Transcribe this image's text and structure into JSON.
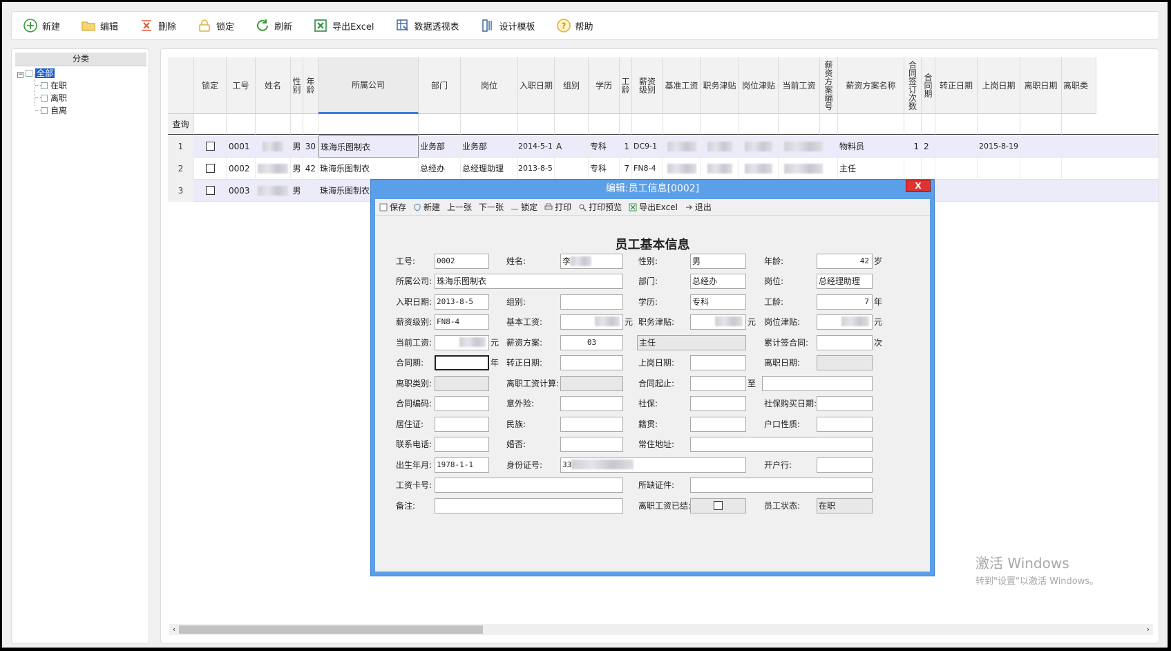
{
  "toolbar": {
    "new": "新建",
    "edit": "编辑",
    "delete": "删除",
    "lock": "锁定",
    "refresh": "刷新",
    "export": "导出Excel",
    "pivot": "数据透视表",
    "template": "设计模板",
    "help": "帮助"
  },
  "tree": {
    "header": "分类",
    "root": "全部",
    "children": [
      "在职",
      "离职",
      "自离"
    ]
  },
  "grid": {
    "filter_label": "查询",
    "headers": [
      "锁定",
      "工号",
      "姓名",
      "性别",
      "年龄",
      "所属公司",
      "部门",
      "岗位",
      "入职日期",
      "组别",
      "学历",
      "工龄",
      "薪资级别",
      "基准工资",
      "职务津贴",
      "岗位津贴",
      "当前工资",
      "薪资方案编号",
      "薪资方案名称",
      "合同签订次数",
      "合同期",
      "转正日期",
      "上岗日期",
      "离职日期",
      "离职类"
    ],
    "rows": [
      {
        "num": "1",
        "id": "0001",
        "gender": "男",
        "age": "30",
        "company": "珠海乐图制衣",
        "dept": "业务部",
        "post": "业务部",
        "hire_date": "2014-5-1",
        "group": "A",
        "edu": "专科",
        "seniority": "1",
        "grade": "DC9-1",
        "plan_name": "物料员",
        "contracts": "1",
        "contract_period": "2",
        "onpost_date": "2015-8-19"
      },
      {
        "num": "2",
        "id": "0002",
        "gender": "男",
        "age": "42",
        "company": "珠海乐图制衣",
        "dept": "总经办",
        "post": "总经理助理",
        "hire_date": "2013-8-5",
        "group": "",
        "edu": "专科",
        "seniority": "7",
        "grade": "FN8-4",
        "plan_name": "主任",
        "contracts": "",
        "contract_period": "",
        "onpost_date": ""
      },
      {
        "num": "3",
        "id": "0003",
        "gender": "男",
        "age": "",
        "company": "珠海乐图制衣",
        "dept": "",
        "post": "",
        "hire_date": "",
        "group": "",
        "edu": "",
        "seniority": "",
        "grade": "",
        "plan_name": "",
        "contracts": "",
        "contract_period": "",
        "onpost_date": ""
      }
    ]
  },
  "watermark": {
    "line1": "激活 Windows",
    "line2": "转到\"设置\"以激活 Windows。"
  },
  "dialog": {
    "title": "编辑:员工信息[0002]",
    "close": "X",
    "toolbar": {
      "save": "保存",
      "new": "新建",
      "prev": "上一张",
      "next": "下一张",
      "lock": "锁定",
      "print": "打印",
      "preview": "打印预览",
      "export": "导出Excel",
      "exit": "退出"
    },
    "form_title": "员工基本信息",
    "labels": {
      "id": "工号:",
      "name": "姓名:",
      "gender": "性别:",
      "age": "年龄:",
      "company": "所属公司:",
      "dept": "部门:",
      "post": "岗位:",
      "hire_date": "入职日期:",
      "group": "组别:",
      "edu": "学历:",
      "seniority": "工龄:",
      "grade": "薪资级别:",
      "base_salary": "基本工资:",
      "duty_allow": "职务津贴:",
      "post_allow": "岗位津贴:",
      "cur_salary": "当前工资:",
      "plan": "薪资方案:",
      "contracts": "累计签合同:",
      "contract_period": "合同期:",
      "confirm_date": "转正日期:",
      "onpost_date": "上岗日期:",
      "leave_date": "离职日期:",
      "leave_type": "离职类别:",
      "leave_calc": "离职工资计算:",
      "contract_range": "合同起止:",
      "contract_no": "合同编码:",
      "insurance": "意外险:",
      "social": "社保:",
      "social_date": "社保购买日期:",
      "residence": "居住证:",
      "ethnic": "民族:",
      "native": "籍贯:",
      "hukou": "户口性质:",
      "phone": "联系电话:",
      "married": "婚否:",
      "address": "常住地址:",
      "birth": "出生年月:",
      "idcard": "身份证号:",
      "bank": "开户行:",
      "salary_card": "工资卡号:",
      "missing_docs": "所缺证件:",
      "remark": "备注:",
      "leave_settled": "离职工资已结:",
      "status": "员工状态:"
    },
    "units": {
      "age": "岁",
      "seniority": "年",
      "yuan": "元",
      "times": "次",
      "year": "年",
      "to": "至"
    },
    "values": {
      "id": "0002",
      "name_prefix": "李",
      "gender": "男",
      "age": "42",
      "company": "珠海乐图制衣",
      "dept": "总经办",
      "post": "总经理助理",
      "hire_date": "2013-8-5",
      "edu": "专科",
      "seniority": "7",
      "grade": "FN8-4",
      "plan_no": "03",
      "plan_name": "主任",
      "birth": "1978-1-1",
      "idcard_prefix": "33",
      "status": "在职"
    }
  },
  "colors": {
    "accent": "#3b7ddd",
    "dialog_frame": "#5b9fe8",
    "close": "#dd3333",
    "tree_selected": "#1f5fd1",
    "row_alt": "#ecebfa"
  }
}
